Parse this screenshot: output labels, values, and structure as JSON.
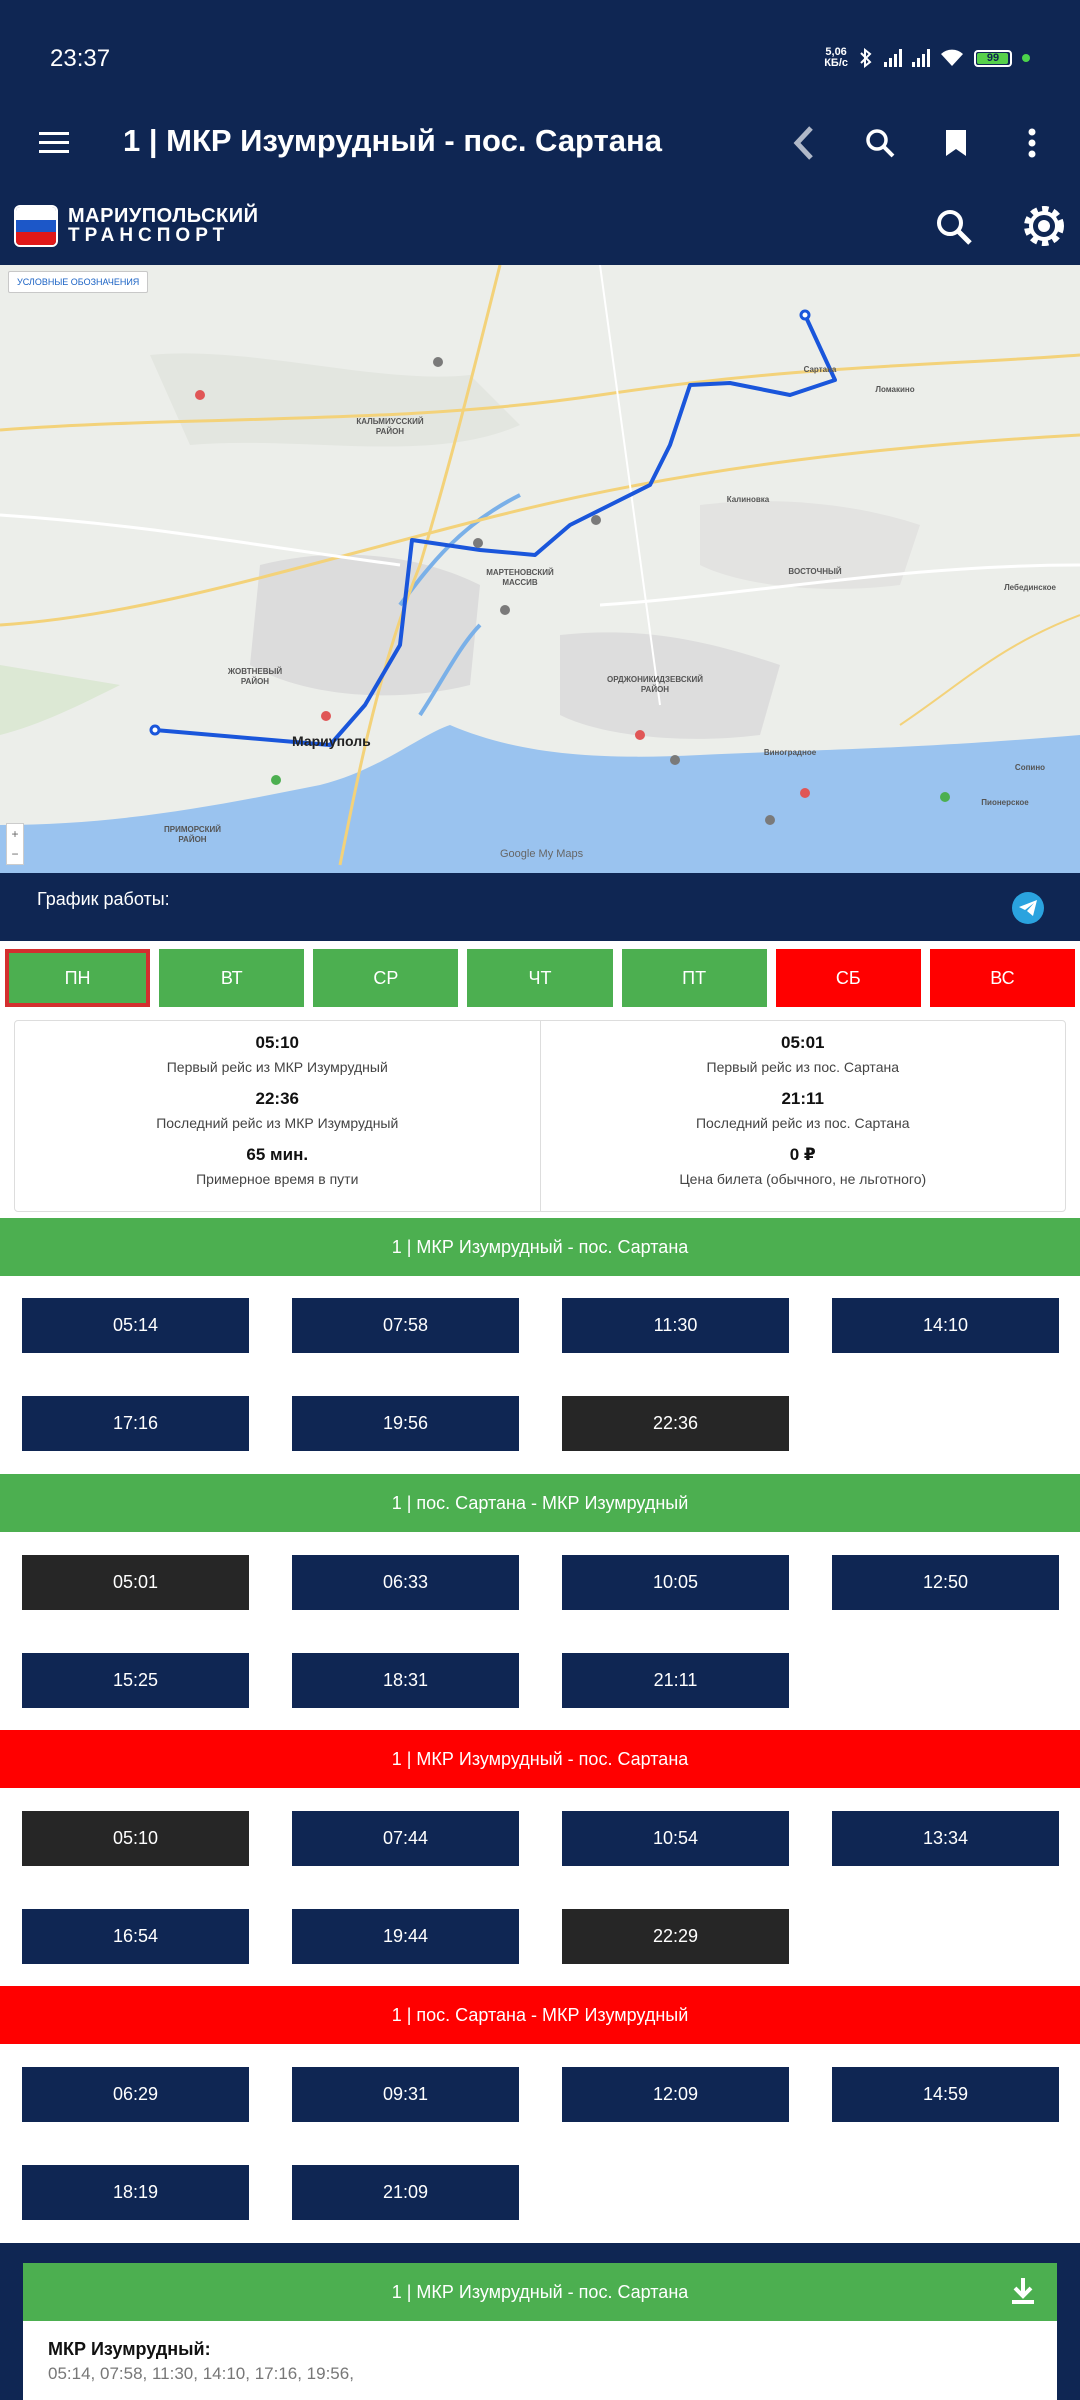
{
  "status": {
    "time": "23:37",
    "net_speed": "5,06",
    "net_unit": "КБ/с",
    "battery": "99"
  },
  "appbar": {
    "title": "1 | МКР Изумрудный - пос. Сартана"
  },
  "site": {
    "logo_line1": "МАРИУПОЛЬСКИЙ",
    "logo_line2": "ТРАНСПОРТ"
  },
  "map": {
    "legend_button": "УСЛОВНЫЕ ОБОЗНАЧЕНИЯ",
    "city_label": "Мариуполь",
    "brand": "Google My Maps",
    "district_labels": [
      "КАЛЬМИУССКИЙ РАЙОН",
      "ЖОВТНЕВЫЙ РАЙОН",
      "ПРИМОРСКИЙ РАЙОН",
      "ОРДЖОНИКИДЗЕВСКИЙ РАЙОН",
      "МАРТЕНОВСКИЙ МАССИВ",
      "ВОСТОЧНЫЙ"
    ],
    "place_labels": [
      "Сартана",
      "Калиновка",
      "Ломакино",
      "Виноградное",
      "Пионерское",
      "Сопино",
      "Лебединское"
    ]
  },
  "schedule": {
    "label": "График работы:"
  },
  "days": [
    {
      "label": "ПН",
      "color": "green",
      "active": true
    },
    {
      "label": "ВТ",
      "color": "green",
      "active": false
    },
    {
      "label": "СР",
      "color": "green",
      "active": false
    },
    {
      "label": "ЧТ",
      "color": "green",
      "active": false
    },
    {
      "label": "ПТ",
      "color": "green",
      "active": false
    },
    {
      "label": "СБ",
      "color": "red",
      "active": false
    },
    {
      "label": "ВС",
      "color": "red",
      "active": false
    }
  ],
  "info": {
    "left": [
      {
        "value": "05:10",
        "desc": "Первый рейс из МКР Изумрудный"
      },
      {
        "value": "22:36",
        "desc": "Последний рейс из МКР Изумрудный"
      },
      {
        "value": "65 мин.",
        "desc": "Примерное время в пути"
      }
    ],
    "right": [
      {
        "value": "05:01",
        "desc": "Первый рейс из пос. Сартана"
      },
      {
        "value": "21:11",
        "desc": "Последний рейс из пос. Сартана"
      },
      {
        "value": "0 ₽",
        "desc": "Цена билета (обычного, не льготного)"
      }
    ]
  },
  "sections": [
    {
      "title": "1 | МКР Изумрудный - пос. Сартана",
      "color": "green",
      "times": [
        {
          "t": "05:14",
          "dark": false
        },
        {
          "t": "07:58",
          "dark": false
        },
        {
          "t": "11:30",
          "dark": false
        },
        {
          "t": "14:10",
          "dark": false
        },
        {
          "t": "17:16",
          "dark": false
        },
        {
          "t": "19:56",
          "dark": false
        },
        {
          "t": "22:36",
          "dark": true
        }
      ]
    },
    {
      "title": "1 | пос. Сартана - МКР Изумрудный",
      "color": "green",
      "times": [
        {
          "t": "05:01",
          "dark": true
        },
        {
          "t": "06:33",
          "dark": false
        },
        {
          "t": "10:05",
          "dark": false
        },
        {
          "t": "12:50",
          "dark": false
        },
        {
          "t": "15:25",
          "dark": false
        },
        {
          "t": "18:31",
          "dark": false
        },
        {
          "t": "21:11",
          "dark": false
        }
      ]
    },
    {
      "title": "1 | МКР Изумрудный - пос. Сартана",
      "color": "red",
      "times": [
        {
          "t": "05:10",
          "dark": true
        },
        {
          "t": "07:44",
          "dark": false
        },
        {
          "t": "10:54",
          "dark": false
        },
        {
          "t": "13:34",
          "dark": false
        },
        {
          "t": "16:54",
          "dark": false
        },
        {
          "t": "19:44",
          "dark": false
        },
        {
          "t": "22:29",
          "dark": true
        }
      ]
    },
    {
      "title": "1 | пос. Сартана - МКР Изумрудный",
      "color": "red",
      "times": [
        {
          "t": "06:29",
          "dark": false
        },
        {
          "t": "09:31",
          "dark": false
        },
        {
          "t": "12:09",
          "dark": false
        },
        {
          "t": "14:59",
          "dark": false
        },
        {
          "t": "18:19",
          "dark": false
        },
        {
          "t": "21:09",
          "dark": false
        }
      ]
    }
  ],
  "bottom": {
    "title": "1 | МКР Изумрудный - пос. Сартана",
    "stop": "МКР Изумрудный:",
    "times": "05:14, 07:58, 11:30, 14:10, 17:16, 19:56,"
  },
  "colors": {
    "navy": "#0f2653",
    "green": "#4caf50",
    "red": "#ff0000",
    "dark": "#262626",
    "route": "#1a56db"
  }
}
